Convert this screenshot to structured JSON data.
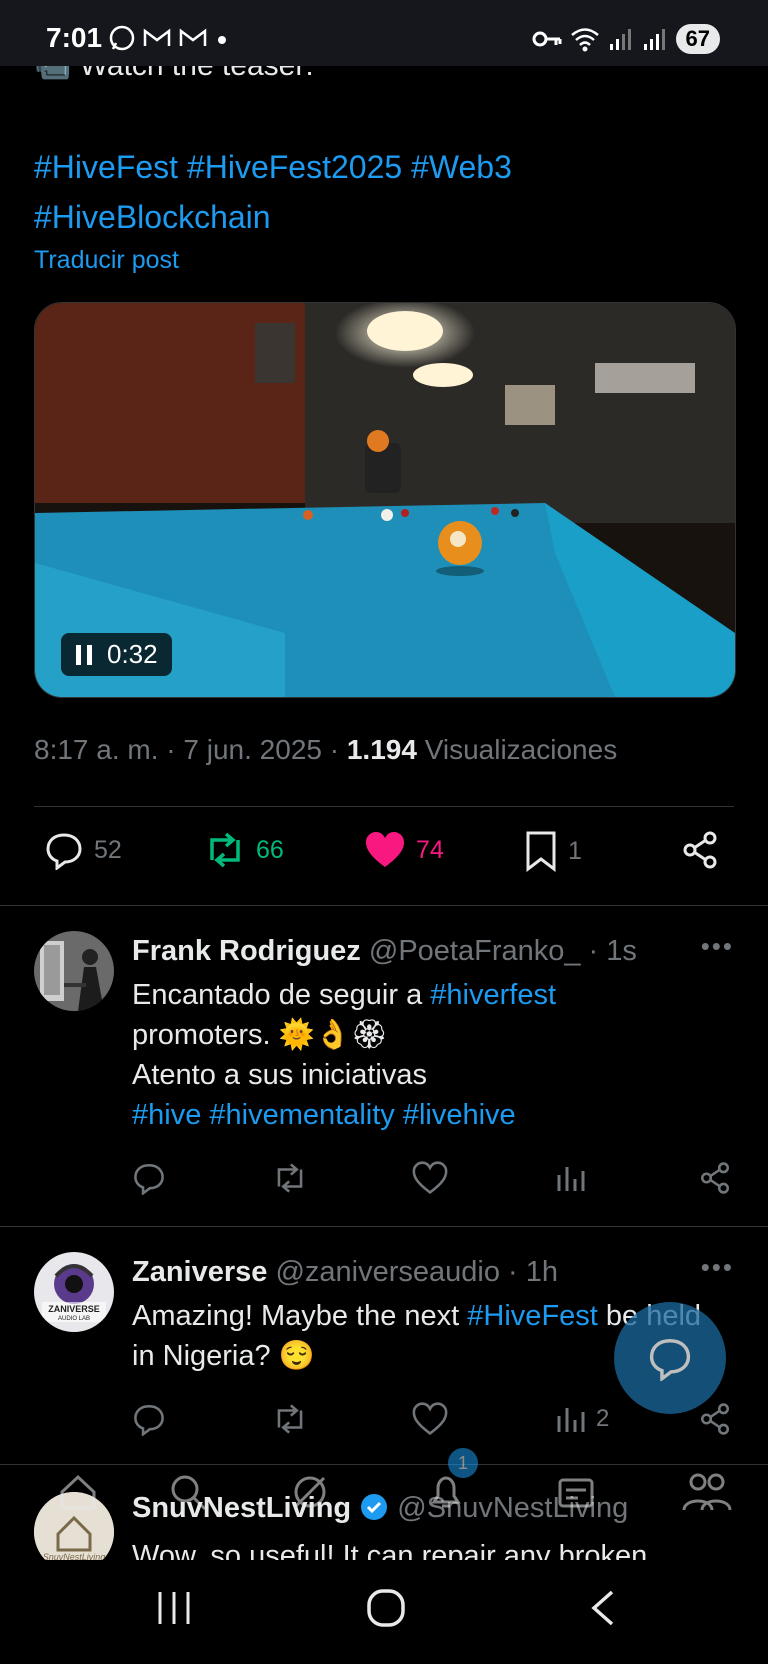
{
  "status": {
    "time": "7:01",
    "battery": "67",
    "notif_icons": [
      "whatsapp-icon",
      "gmail-icon",
      "gmail-icon"
    ]
  },
  "post": {
    "teaser_text": "📹 Watch the teaser:",
    "hashtags_line1": "#HiveFest #HiveFest2025 #Web3",
    "hashtags_line2": "#HiveBlockchain",
    "translate": "Traducir post",
    "video_time": "0:32",
    "meta_time": "8:17 a. m. · 7 jun. 2025 · ",
    "views_count": "1.194",
    "views_label": " Visualizaciones",
    "replies": "52",
    "reposts": "66",
    "likes": "74",
    "bookmarks": "1"
  },
  "replies": [
    {
      "name": "Frank Rodriguez",
      "handle": "@PoetaFranko_ · 1s",
      "line1_text": "Encantado de seguir a ",
      "line1_tag": "#hiverfest",
      "line2": "promoters. 🌞👌🏵",
      "line3": "Atento a sus iniciativas",
      "line4": "#hive #hivementality #livehive",
      "views": ""
    },
    {
      "name": "Zaniverse",
      "handle": "@zaniverseaudio · 1h",
      "line1_text": "Amazing! Maybe the next ",
      "line1_tag": "#HiveFest",
      "line1_rest": " be held",
      "line2": "in Nigeria? 😌",
      "views": "2",
      "avatar_label1": "ZANIVERSE",
      "avatar_label2": "AUDIO LAB"
    },
    {
      "name": "SnuvNestLiving",
      "handle": "@SnuvNestLiving",
      "line1": "Wow, so useful! It can repair any broken",
      "avatar_label": "SnuvNestLiving"
    }
  ],
  "bottom_nav": {
    "notifications_badge": "1"
  },
  "colors": {
    "accent": "#1d9bf0",
    "like": "#f91880",
    "repost": "#00ba7c",
    "muted": "#71767b"
  }
}
